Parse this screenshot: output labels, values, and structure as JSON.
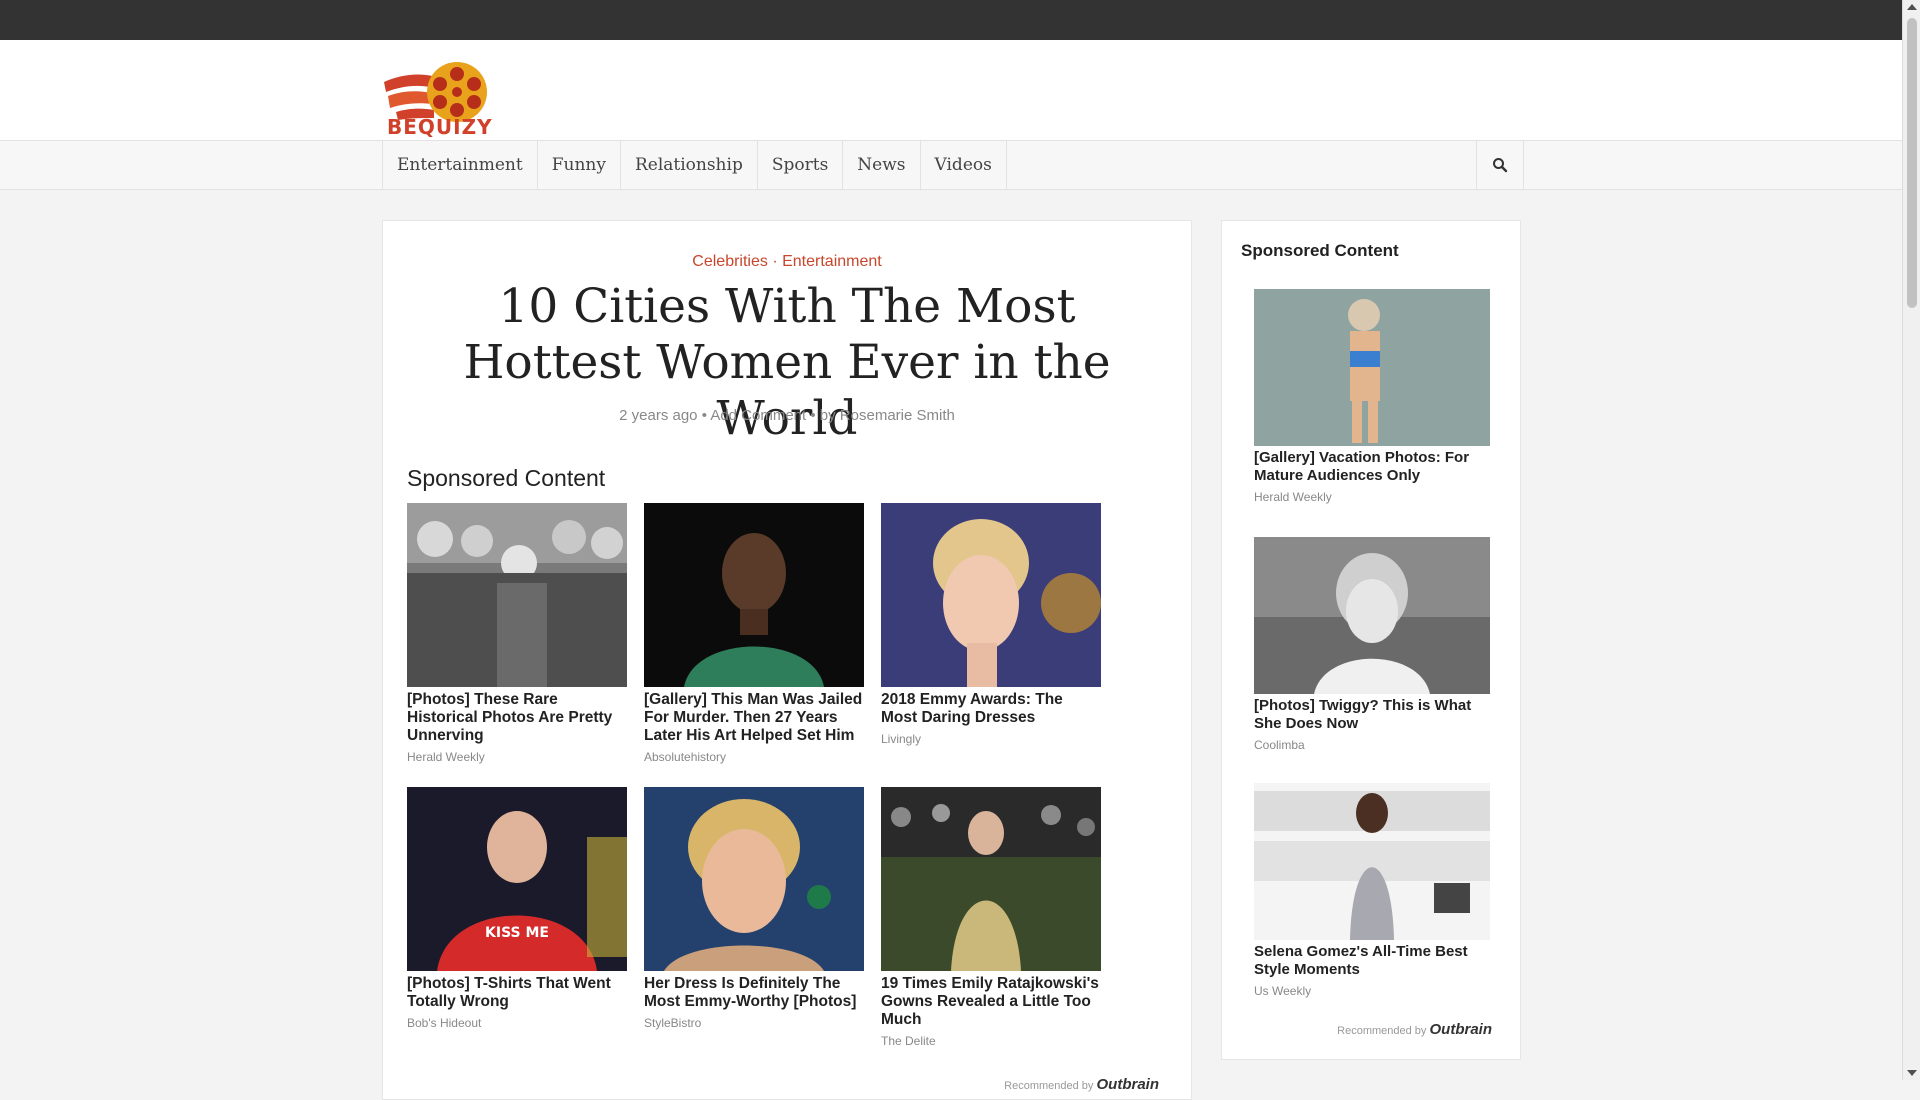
{
  "site": {
    "logo_text": "BEQUIZY"
  },
  "nav": {
    "items": [
      "Entertainment",
      "Funny",
      "Relationship",
      "Sports",
      "News",
      "Videos"
    ]
  },
  "article": {
    "category_1": "Celebrities",
    "category_sep": "·",
    "category_2": "Entertainment",
    "title": "10 Cities With The Most Hottest Women Ever in the World",
    "meta": {
      "time": "2 years ago",
      "comment": "Add Comment",
      "author": "by Rosemarie Smith",
      "sep": "•"
    }
  },
  "sponsored": {
    "heading": "Sponsored Content",
    "items": [
      {
        "title": "[Photos] These Rare Historical Photos Are Pretty Unnerving",
        "source": "Herald Weekly"
      },
      {
        "title": "[Gallery] This Man Was Jailed For Murder. Then 27 Years Later His Art Helped Set Him",
        "source": "Absolutehistory"
      },
      {
        "title": "2018 Emmy Awards: The Most Daring Dresses",
        "source": "Livingly"
      },
      {
        "title": "[Photos] T-Shirts That Went Totally Wrong",
        "source": "Bob's Hideout"
      },
      {
        "title": "Her Dress Is Definitely The Most Emmy-Worthy [Photos]",
        "source": "StyleBistro"
      },
      {
        "title": "19 Times Emily Ratajkowski's Gowns Revealed a Little Too Much",
        "source": "The Delite"
      }
    ],
    "recommended_prefix": "Recommended by",
    "recommended_brand": "Outbrain"
  },
  "sidebar": {
    "heading": "Sponsored Content",
    "items": [
      {
        "title": "[Gallery] Vacation Photos: For Mature Audiences Only",
        "source": "Herald Weekly"
      },
      {
        "title": "[Photos] Twiggy? This is What She Does Now",
        "source": "Coolimba"
      },
      {
        "title": "Selena Gomez's All-Time Best Style Moments",
        "source": "Us Weekly"
      }
    ],
    "recommended_prefix": "Recommended by",
    "recommended_brand": "Outbrain"
  },
  "colors": {
    "accent": "#c8462c",
    "topbar": "#333333"
  }
}
